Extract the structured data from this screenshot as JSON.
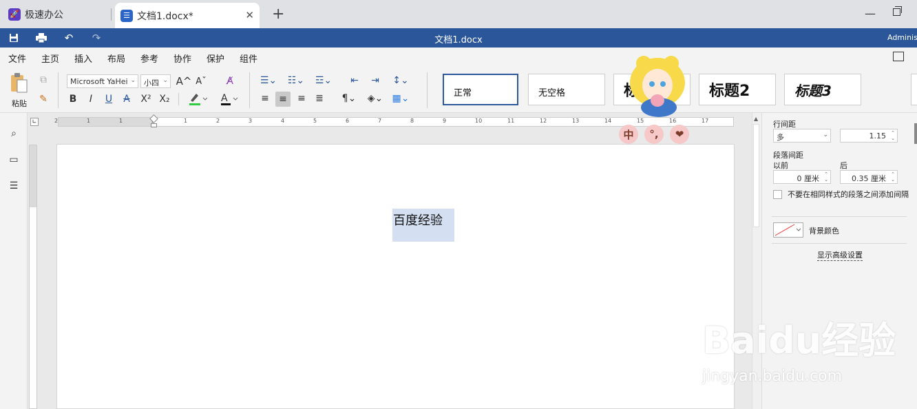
{
  "tabs": [
    {
      "label": "极速办公"
    },
    {
      "label": "文档1.docx*"
    }
  ],
  "title_bar": {
    "doc_title": "文档1.docx",
    "user": "Administ"
  },
  "menu": [
    "文件",
    "主页",
    "插入",
    "布局",
    "参考",
    "协作",
    "保护",
    "组件"
  ],
  "ribbon": {
    "paste_label": "粘贴",
    "font_name": "Microsoft YaHei",
    "font_size": "小四",
    "bold": "B",
    "italic": "I",
    "underline": "U",
    "strike": "A",
    "super": "X²",
    "sub": "X₂",
    "grow": "A^",
    "shrink": "Aˇ"
  },
  "styles": [
    "正常",
    "无空格",
    "标题1",
    "标题2",
    "标题3"
  ],
  "ruler_numbers_h": [
    "2",
    "1",
    "1",
    "2",
    "1",
    "2",
    "3",
    "4",
    "5",
    "6",
    "7",
    "8",
    "9",
    "10",
    "11",
    "12",
    "13",
    "14",
    "15",
    "16",
    "17"
  ],
  "document": {
    "text": "百度经验"
  },
  "panel": {
    "line_spacing_label": "行间距",
    "line_spacing_mode": "多",
    "line_spacing_value": "1.15",
    "para_spacing_label": "段落间距",
    "before_label": "以前",
    "after_label": "后",
    "before_value": "0 厘米",
    "after_value": "0.35 厘米",
    "no_space_same_style": "不要在相同样式的段落之间添加间隔",
    "bg_color_label": "背景颜色",
    "advanced": "显示高级设置"
  },
  "ime": [
    "中",
    "°,",
    "❤"
  ],
  "watermark": {
    "logo": "Baidu经验",
    "url": "jingyan.baidu.com"
  },
  "colors": {
    "accent": "#2b579a",
    "selection": "#d4e0f2"
  }
}
